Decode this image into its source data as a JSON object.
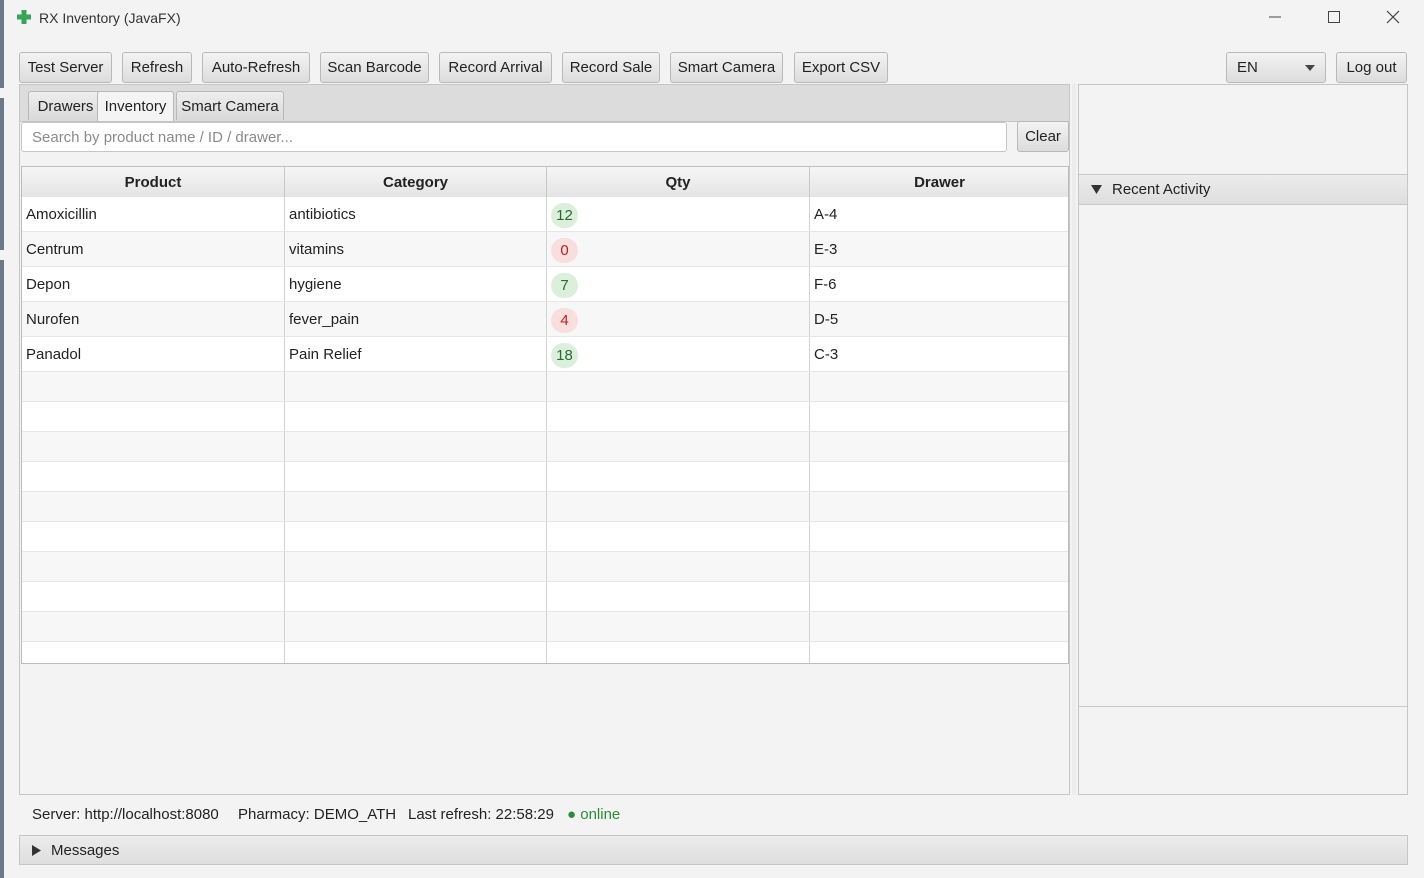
{
  "window": {
    "title": "RX Inventory (JavaFX)",
    "icon": "green-cross-icon",
    "controls": [
      "minimize-icon",
      "maximize-icon",
      "close-icon"
    ]
  },
  "toolbar": {
    "test_server": "Test Server",
    "refresh": "Refresh",
    "auto_refresh": "Auto-Refresh",
    "scan_barcode": "Scan Barcode",
    "record_arrival": "Record Arrival",
    "record_sale": "Record Sale",
    "smart_camera": "Smart Camera",
    "export_csv": "Export CSV",
    "language": "EN",
    "logout": "Log out"
  },
  "tabs": [
    {
      "label": "Drawers",
      "active": false
    },
    {
      "label": "Inventory",
      "active": true
    },
    {
      "label": "Smart Camera",
      "active": false
    }
  ],
  "search": {
    "placeholder": "Search by product name / ID / drawer...",
    "value": "",
    "clear_label": "Clear"
  },
  "table": {
    "columns": [
      "Product",
      "Category",
      "Qty",
      "Drawer"
    ],
    "rows": [
      {
        "product": "Amoxicillin",
        "category": "antibiotics",
        "qty": "12",
        "qty_status": "ok",
        "drawer": "A-4"
      },
      {
        "product": "Centrum",
        "category": "vitamins",
        "qty": "0",
        "qty_status": "low",
        "drawer": "E-3"
      },
      {
        "product": "Depon",
        "category": "hygiene",
        "qty": "7",
        "qty_status": "ok",
        "drawer": "F-6"
      },
      {
        "product": "Nurofen",
        "category": "fever_pain",
        "qty": "4",
        "qty_status": "low",
        "drawer": "D-5"
      },
      {
        "product": "Panadol",
        "category": "Pain Relief",
        "qty": "18",
        "qty_status": "ok",
        "drawer": "C-3"
      }
    ]
  },
  "recent_activity": {
    "title": "Recent Activity",
    "expanded": true
  },
  "status_bar": {
    "server": "Server: http://localhost:8080",
    "pharmacy": "Pharmacy: DEMO_ATH",
    "last_refresh": "Last refresh: 22:58:29",
    "online": "● online"
  },
  "messages": {
    "title": "Messages",
    "expanded": false
  },
  "colors": {
    "accent_green": "#2e8b3a",
    "badge_ok_bg": "#dcefdc",
    "badge_low_bg": "#f9dede",
    "badge_low_text": "#b42323"
  }
}
